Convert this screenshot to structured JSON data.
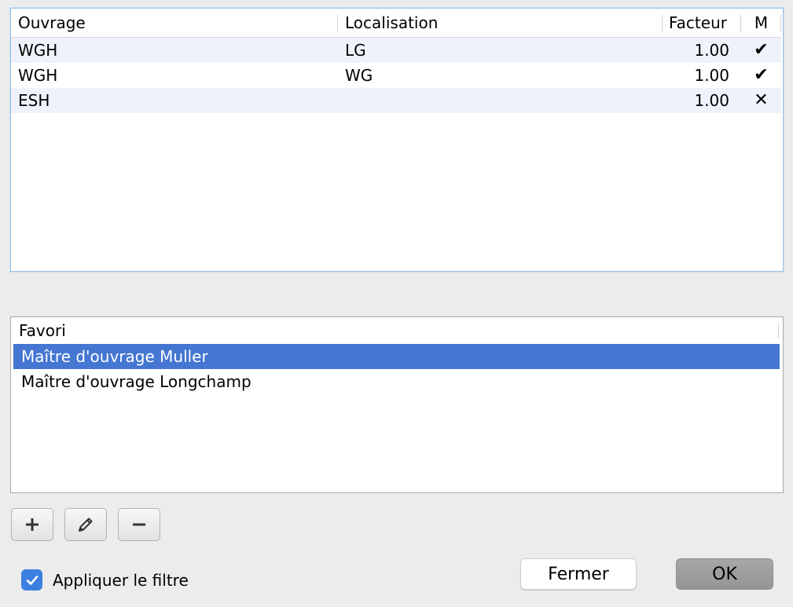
{
  "table": {
    "columns": [
      "Ouvrage",
      "Localisation",
      "Facteur",
      "M"
    ],
    "rows": [
      {
        "ouvrage": "WGH",
        "localisation": "LG",
        "facteur": "1.00",
        "m": "✔"
      },
      {
        "ouvrage": "WGH",
        "localisation": "WG",
        "facteur": "1.00",
        "m": "✔"
      },
      {
        "ouvrage": "ESH",
        "localisation": "",
        "facteur": "1.00",
        "m": "✕"
      }
    ]
  },
  "favorites": {
    "header": "Favori",
    "items": [
      {
        "label": "Maître d'ouvrage Muller",
        "selected": true
      },
      {
        "label": "Maître d'ouvrage Longchamp",
        "selected": false
      }
    ]
  },
  "toolbar": {
    "add_icon": "plus-icon",
    "edit_icon": "pencil-icon",
    "remove_icon": "minus-icon"
  },
  "filter": {
    "label": "Appliquer le filtre",
    "checked": true
  },
  "dialog": {
    "close_label": "Fermer",
    "ok_label": "OK"
  },
  "colors": {
    "selection": "#4476d2",
    "checkbox": "#3b7fe0",
    "row_alt": "#eef3fb"
  }
}
